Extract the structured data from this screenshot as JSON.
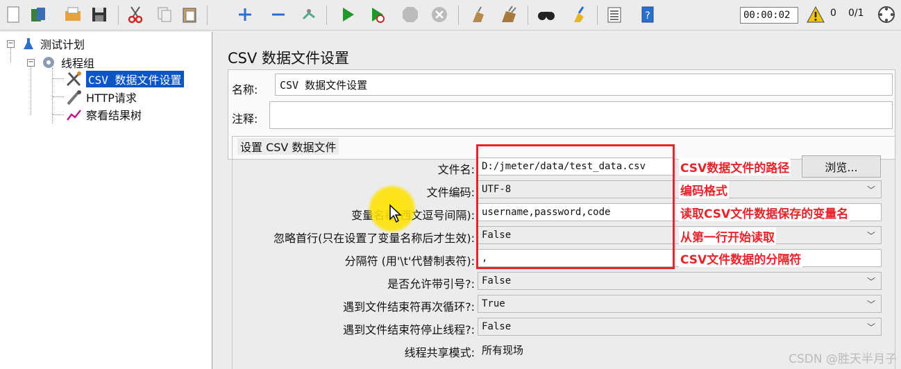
{
  "toolbar": {
    "timer": "00:00:02",
    "warning_count": "0",
    "thread_ratio": "0/1",
    "icons": [
      "new-icon",
      "templates-icon",
      "open-icon",
      "save-icon",
      "cut-icon",
      "copy-icon",
      "paste-icon",
      "expand-icon",
      "collapse-icon",
      "toggle-icon",
      "start-icon",
      "start-no-pause-icon",
      "stop-icon",
      "shutdown-icon",
      "clear-icon",
      "clear-all-icon",
      "search-icon",
      "reset-search-icon",
      "function-helper-icon",
      "help-icon"
    ]
  },
  "tree": {
    "root": "测试计划",
    "thread_group": "线程组",
    "items": [
      "CSV 数据文件设置",
      "HTTP请求",
      "察看结果树"
    ]
  },
  "panel": {
    "title": "CSV 数据文件设置",
    "name_label": "名称:",
    "name_value": "CSV 数据文件设置",
    "comment_label": "注释:",
    "comment_value": "",
    "group_title": "设置 CSV 数据文件",
    "browse_label": "浏览...",
    "rows": [
      {
        "label": "文件名:",
        "value": "D:/jmeter/data/test_data.csv"
      },
      {
        "label": "文件编码:",
        "value": "UTF-8"
      },
      {
        "label": "变量名称(西文逗号间隔):",
        "value": "username,password,code"
      },
      {
        "label": "忽略首行(只在设置了变量名称后才生效):",
        "value": "False"
      },
      {
        "label": "分隔符 (用'\\t'代替制表符):",
        "value": ","
      },
      {
        "label": "是否允许带引号?:",
        "value": "False"
      },
      {
        "label": "遇到文件结束符再次循环?:",
        "value": "True"
      },
      {
        "label": "遇到文件结束符停止线程?:",
        "value": "False"
      },
      {
        "label": "线程共享模式:",
        "value": "所有现场"
      }
    ]
  },
  "annotations": [
    "CSV数据文件的路径",
    "编码格式",
    "读取CSV文件数据保存的变量名",
    "从第一行开始读取",
    "CSV文件数据的分隔符"
  ],
  "watermark": "CSDN @胜天半月子",
  "colors": {
    "annotation": "#e8242b",
    "selection": "#0b55c6"
  }
}
